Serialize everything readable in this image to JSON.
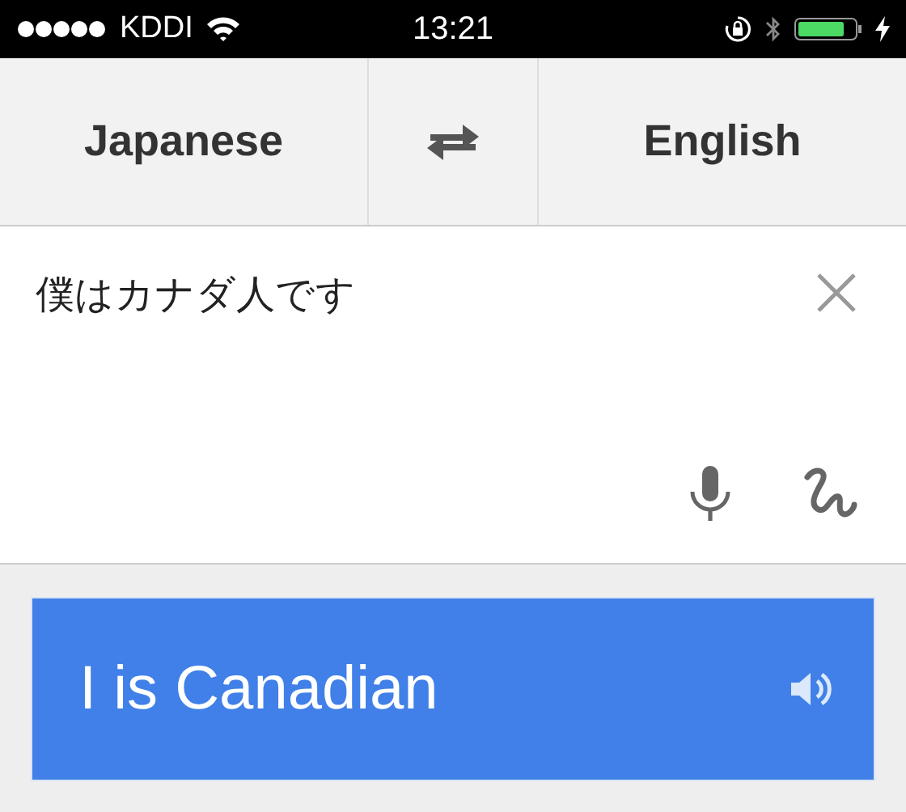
{
  "status_bar": {
    "carrier": "KDDI",
    "time": "13:21"
  },
  "languages": {
    "source": "Japanese",
    "target": "English"
  },
  "input": {
    "value": "僕はカナダ人です"
  },
  "translation": {
    "text": "I is Canadian"
  }
}
